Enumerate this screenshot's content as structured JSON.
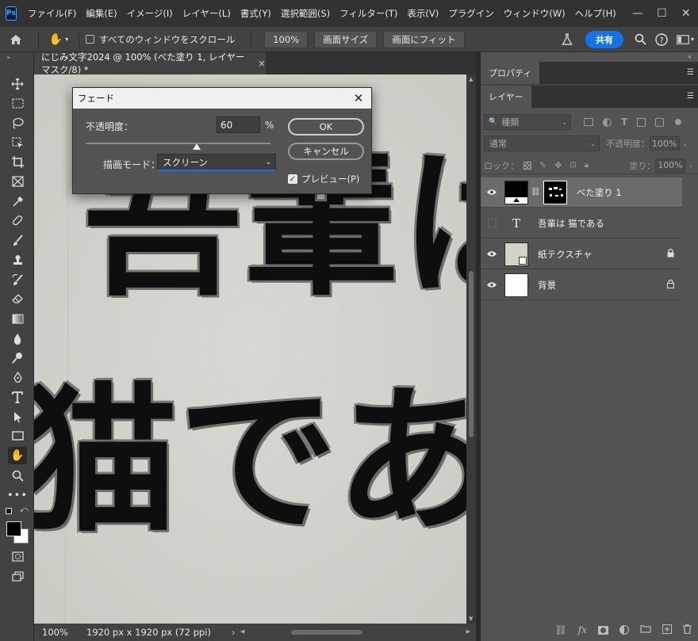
{
  "menubar": {
    "logo": "Ps",
    "items": [
      "ファイル(F)",
      "編集(E)",
      "イメージ(I)",
      "レイヤー(L)",
      "書式(Y)",
      "選択範囲(S)",
      "フィルター(T)",
      "表示(V)",
      "プラグイン",
      "ウィンドウ(W)",
      "ヘルプ(H)"
    ],
    "window_controls": [
      "—",
      "☐",
      "✕"
    ]
  },
  "options_bar": {
    "scroll_all_label": "すべてのウィンドウをスクロール",
    "zoom_button": "100%",
    "fit_screen_button": "画面サイズ",
    "fill_screen_button": "画面にフィット",
    "share_button": "共有"
  },
  "document": {
    "tab_title": "にじみ文字2024 @ 100% (べた塗り 1, レイヤーマスク/8) *",
    "tab_close": "×",
    "canvas_line1": "吾輩は",
    "canvas_line2": "猫であ",
    "zoom": "100%",
    "doc_info": "1920 px x 1920 px (72 ppi)",
    "status_arrow": "›"
  },
  "dialog": {
    "title": "フェード",
    "opacity_label": "不透明度：",
    "opacity_value": "60",
    "opacity_unit": "%",
    "opacity_percent": 60,
    "mode_label": "描画モード：",
    "mode_value": "スクリーン",
    "ok_button": "OK",
    "cancel_button": "キャンセル",
    "preview_label": "プレビュー(P)",
    "preview_checked": true
  },
  "properties_panel": {
    "tab": "プロパティ"
  },
  "layers_panel": {
    "tab": "レイヤー",
    "filter_kind": "種類",
    "blend_mode": "通常",
    "opacity_label": "不透明度：",
    "opacity_value": "100%",
    "lock_label": "ロック：",
    "fill_label": "塗り：",
    "fill_value": "100%",
    "layers": [
      {
        "name": "べた塗り 1",
        "visible": true,
        "selected": true,
        "locked": false
      },
      {
        "name": "吾輩は 猫である",
        "visible": false,
        "selected": false,
        "locked": false
      },
      {
        "name": "紙テクスチャ",
        "visible": true,
        "selected": false,
        "locked": true
      },
      {
        "name": "背景",
        "visible": true,
        "selected": false,
        "locked": true
      }
    ],
    "type_layer_icon": "T",
    "bottom_icons": [
      "link-icon",
      "fx-icon",
      "mask-icon",
      "adjustment-icon",
      "folder-icon",
      "new-layer-icon",
      "trash-icon"
    ]
  },
  "colors": {
    "accent": "#1473e6",
    "panel_bg": "#535353",
    "dark_bg": "#323232",
    "canvas_paper": "#d6d5cf"
  }
}
